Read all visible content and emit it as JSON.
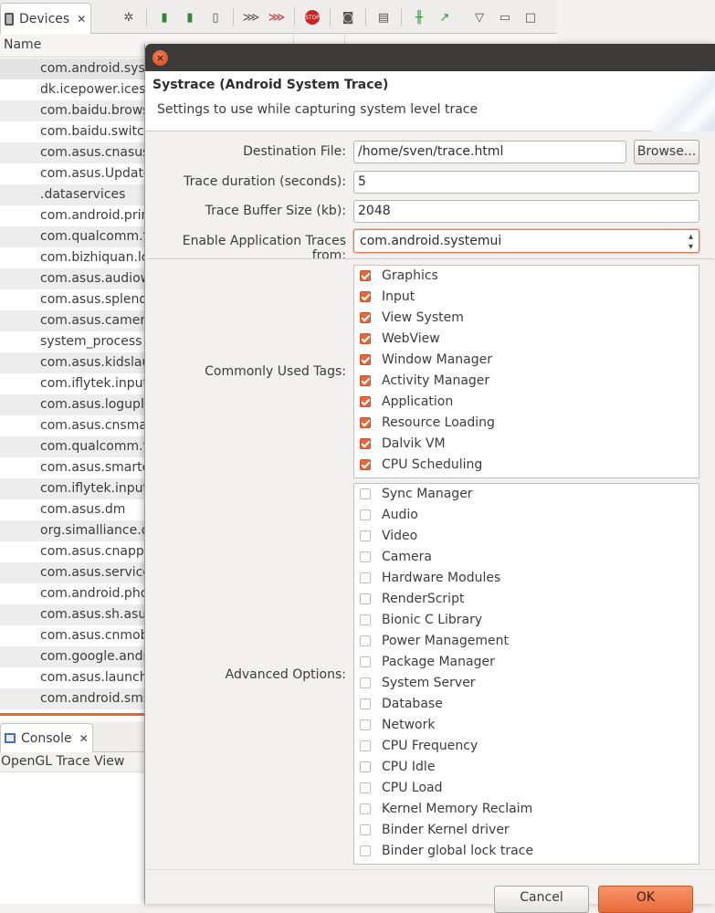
{
  "background": {
    "devices_tab": {
      "label": "Devices"
    },
    "name_header": "Name",
    "processes": [
      "com.android.syst",
      "dk.icepower.icesc",
      "com.baidu.brows",
      "com.baidu.switch",
      "com.asus.cnasusi",
      "com.asus.Update",
      ".dataservices",
      "com.android.prir",
      "com.qualcomm.t",
      "com.bizhiquan.lo",
      "com.asus.audiow",
      "com.asus.splendi",
      "com.asus.camera",
      "system_process",
      "com.asus.kidslau",
      "com.iflytek.input",
      "com.asus.loguplo",
      "com.asus.cnsmar",
      "com.qualcomm.t",
      "com.asus.smartc",
      "com.iflytek.input",
      "com.asus.dm",
      "org.simalliance.o",
      "com.asus.cnapps",
      "com.asus.service",
      "com.android.pho",
      "com.asus.sh.asus",
      "com.asus.cnmobi",
      "com.google.andr",
      "com.asus.launche",
      "com.android.sms"
    ],
    "console_tab": {
      "label": "Console"
    },
    "opengl_label": "OpenGL Trace View"
  },
  "dialog": {
    "title": "Systrace (Android System Trace)",
    "subtitle": "Settings to use while capturing system level trace",
    "destination_label": "Destination File:",
    "destination_value": "/home/sven/trace.html",
    "browse_label": "Browse...",
    "duration_label": "Trace duration (seconds):",
    "duration_value": "5",
    "buffer_label": "Trace Buffer Size (kb):",
    "buffer_value": "2048",
    "app_traces_label": "Enable Application Traces from:",
    "app_traces_value": "com.android.systemui",
    "common_tags_label": "Commonly Used Tags:",
    "common_tags": [
      {
        "label": "Graphics",
        "checked": true
      },
      {
        "label": "Input",
        "checked": true
      },
      {
        "label": "View System",
        "checked": true
      },
      {
        "label": "WebView",
        "checked": true
      },
      {
        "label": "Window Manager",
        "checked": true
      },
      {
        "label": "Activity Manager",
        "checked": true
      },
      {
        "label": "Application",
        "checked": true
      },
      {
        "label": "Resource Loading",
        "checked": true
      },
      {
        "label": "Dalvik VM",
        "checked": true
      },
      {
        "label": "CPU Scheduling",
        "checked": true
      }
    ],
    "advanced_label": "Advanced Options:",
    "advanced_tags": [
      {
        "label": "Sync Manager",
        "checked": false
      },
      {
        "label": "Audio",
        "checked": false
      },
      {
        "label": "Video",
        "checked": false
      },
      {
        "label": "Camera",
        "checked": false
      },
      {
        "label": "Hardware Modules",
        "checked": false
      },
      {
        "label": "RenderScript",
        "checked": false
      },
      {
        "label": "Bionic C Library",
        "checked": false
      },
      {
        "label": "Power Management",
        "checked": false
      },
      {
        "label": "Package Manager",
        "checked": false
      },
      {
        "label": "System Server",
        "checked": false
      },
      {
        "label": "Database",
        "checked": false
      },
      {
        "label": "Network",
        "checked": false
      },
      {
        "label": "CPU Frequency",
        "checked": false
      },
      {
        "label": "CPU Idle",
        "checked": false
      },
      {
        "label": "CPU Load",
        "checked": false
      },
      {
        "label": "Kernel Memory Reclaim",
        "checked": false
      },
      {
        "label": "Binder Kernel driver",
        "checked": false
      },
      {
        "label": "Binder global lock trace",
        "checked": false
      }
    ],
    "cancel_label": "Cancel",
    "ok_label": "OK"
  },
  "colors": {
    "accent": "#e86b3a",
    "titlebar": "#3c3b37"
  }
}
